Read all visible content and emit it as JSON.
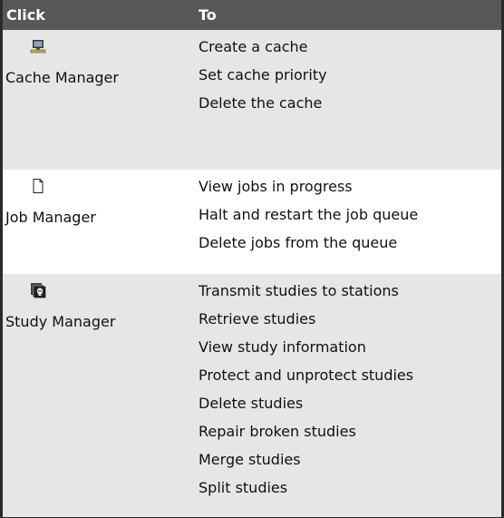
{
  "header": {
    "col1": "Click",
    "col2": "To"
  },
  "groups": [
    {
      "name": "Cache Manager",
      "icon": "computer-icon",
      "actions": [
        "Create a cache",
        "Set cache priority",
        "Delete the cache"
      ]
    },
    {
      "name": "Job Manager",
      "icon": "document-icon",
      "actions": [
        "View jobs in progress",
        "Halt and restart the job queue",
        "Delete jobs from the queue"
      ]
    },
    {
      "name": "Study Manager",
      "icon": "study-icon",
      "actions": [
        "Transmit studies to stations",
        "Retrieve studies",
        "View study information",
        "Protect and unprotect studies",
        "Delete studies",
        "Repair broken studies",
        "Merge studies",
        "Split studies"
      ]
    }
  ],
  "colors": {
    "header_bg": "#585858",
    "shaded_row": "#e6e6e6",
    "border": "#2a2a2a"
  }
}
